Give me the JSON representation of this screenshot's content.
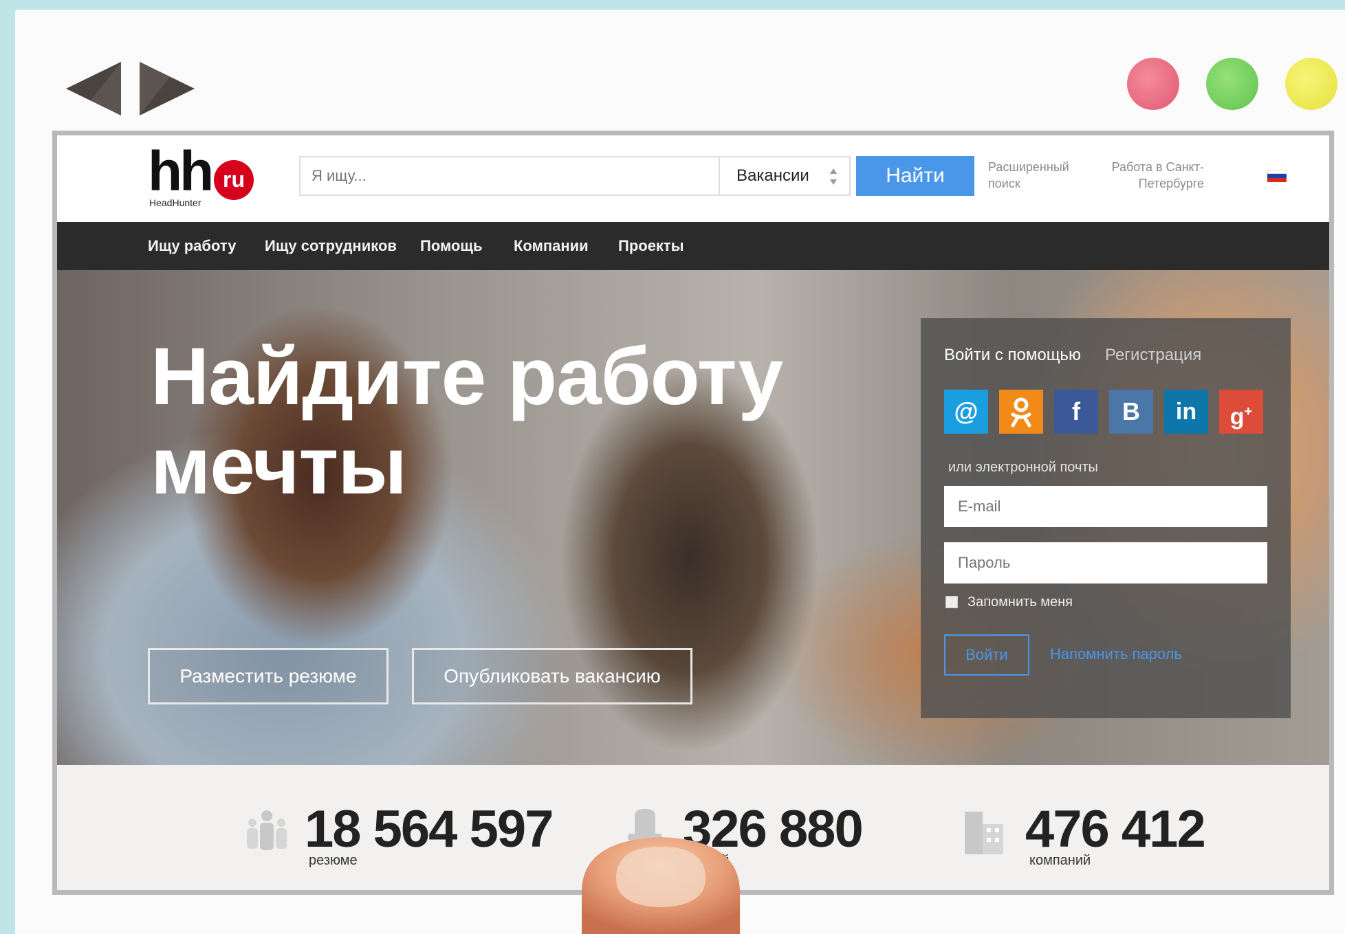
{
  "window": {
    "dots": [
      "#e05a72",
      "#5fc44a",
      "#e6e03a"
    ]
  },
  "header": {
    "logo_main": "hh",
    "logo_badge": "ru",
    "logo_sub": "HeadHunter",
    "search_placeholder": "Я ищу...",
    "search_type": "Вакансии",
    "find_label": "Найти",
    "advanced_search": "Расширенный поиск",
    "city_label": "Работа в Санкт-Петербурге"
  },
  "nav": {
    "items": [
      "Ищу работу",
      "Ищу сотрудников",
      "Помощь",
      "Компании",
      "Проекты"
    ]
  },
  "hero": {
    "title_line1": "Найдите работу",
    "title_line2": "мечты",
    "post_resume": "Разместить резюме",
    "post_vacancy": "Опубликовать вакансию"
  },
  "login": {
    "tab_login": "Войти с помощью",
    "tab_register": "Регистрация",
    "social": [
      {
        "name": "mail-ru-icon",
        "glyph": "@",
        "color": "#1a9ee0"
      },
      {
        "name": "odnoklassniki-icon",
        "glyph": "ok",
        "color": "#f28a18"
      },
      {
        "name": "facebook-icon",
        "glyph": "f",
        "color": "#3b5998"
      },
      {
        "name": "vkontakte-icon",
        "glyph": "B",
        "color": "#4a76a8"
      },
      {
        "name": "linkedin-icon",
        "glyph": "in",
        "color": "#0e76a8"
      },
      {
        "name": "google-plus-icon",
        "glyph": "g+",
        "color": "#dd4b39"
      }
    ],
    "or_email": "или электронной почты",
    "email_placeholder": "E-mail",
    "password_placeholder": "Пароль",
    "remember": "Запомнить меня",
    "submit": "Войти",
    "forgot": "Напомнить пароль"
  },
  "stats": [
    {
      "value": "18 564 597",
      "label": "резюме"
    },
    {
      "value": "326 880",
      "label": "нсий"
    },
    {
      "value": "476 412",
      "label": "компаний"
    }
  ],
  "colors": {
    "accent": "#4a96e8",
    "brand_red": "#d6001c",
    "navbar": "#2b2b2b"
  }
}
